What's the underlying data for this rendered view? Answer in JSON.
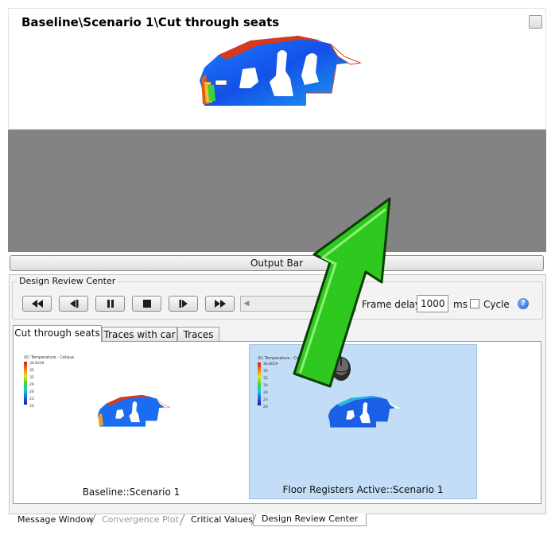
{
  "view": {
    "title": "Baseline\\Scenario 1\\Cut through seats"
  },
  "output_bar": {
    "label": "Output Bar"
  },
  "design_review_center": {
    "group_label": "Design Review Center",
    "playback": [
      "rewind-button",
      "step-back-button",
      "pause-button",
      "stop-button",
      "step-forward-button",
      "fast-forward-button"
    ],
    "frame_delay_label": "Frame delay:",
    "frame_delay_value": "1000",
    "ms_label": "ms",
    "cycle_label": "Cycle",
    "cycle_checked": false,
    "help_glyph": "?",
    "tabs": [
      {
        "label": "Cut through seats",
        "active": true
      },
      {
        "label": "Traces with car",
        "active": false
      },
      {
        "label": "Traces",
        "active": false
      }
    ],
    "thumbnails": [
      {
        "label": "Baseline::Scenario 1",
        "legend_title": "(K) Temperature - Celsius",
        "legend_max": "36.8226",
        "ticks": [
          "35",
          "32",
          "29",
          "26",
          "23",
          "20"
        ],
        "selected": false
      },
      {
        "label": "Floor Registers Active::Scenario 1",
        "legend_title": "(K) Temperature - Celsius",
        "legend_max": "36.8659",
        "ticks": [
          "35",
          "32",
          "29",
          "26",
          "23",
          "20"
        ],
        "selected": true
      }
    ]
  },
  "bottom_tabs": [
    {
      "label": "Message Window",
      "enabled": true
    },
    {
      "label": "Convergence Plot",
      "enabled": false
    },
    {
      "label": "Critical Values",
      "enabled": true
    },
    {
      "label": "Design Review Center",
      "active": true
    }
  ],
  "colors": {
    "arrow": "#2ec81e",
    "highlight": "#c2ddf5",
    "viewport_gray": "#838383"
  },
  "icons": [
    "mouse-icon",
    "green-arrow-icon",
    "help-icon"
  ]
}
